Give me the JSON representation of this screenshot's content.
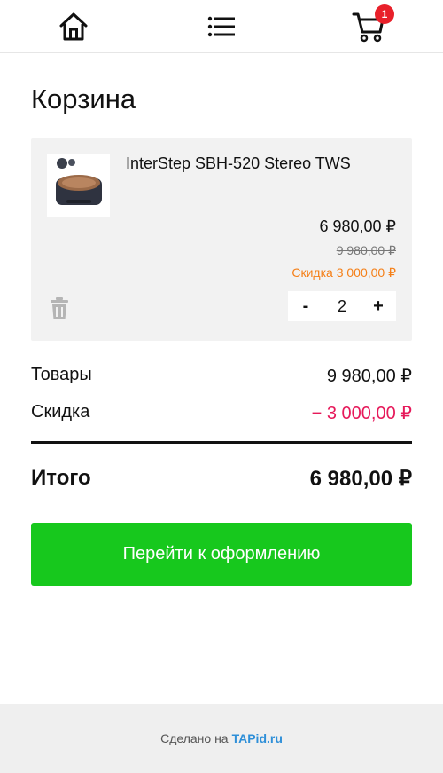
{
  "nav": {
    "home_icon": "home-icon",
    "menu_icon": "list-icon",
    "cart_icon": "cart-icon",
    "cart_count": "1"
  },
  "page": {
    "title": "Корзина"
  },
  "cart_item": {
    "name": "InterStep SBH-520 Stereo TWS",
    "price": "6 980,00 ₽",
    "old_price": "9 980,00 ₽",
    "discount": "Скидка 3 000,00 ₽",
    "quantity": "2",
    "minus_label": "-",
    "plus_label": "+"
  },
  "summary": {
    "goods_label": "Товары",
    "goods_value": "9 980,00 ₽",
    "discount_label": "Скидка",
    "discount_value": "− 3 000,00 ₽",
    "total_label": "Итого",
    "total_value": "6 980,00 ₽"
  },
  "checkout": {
    "label": "Перейти к оформлению"
  },
  "footer": {
    "text": "Сделано на",
    "link": "TAPid.ru"
  },
  "colors": {
    "accent_green": "#17c81d",
    "badge_red": "#e8202a",
    "discount_orange": "#f57f17",
    "discount_pink": "#e6195a",
    "link_blue": "#2e8fd8"
  }
}
